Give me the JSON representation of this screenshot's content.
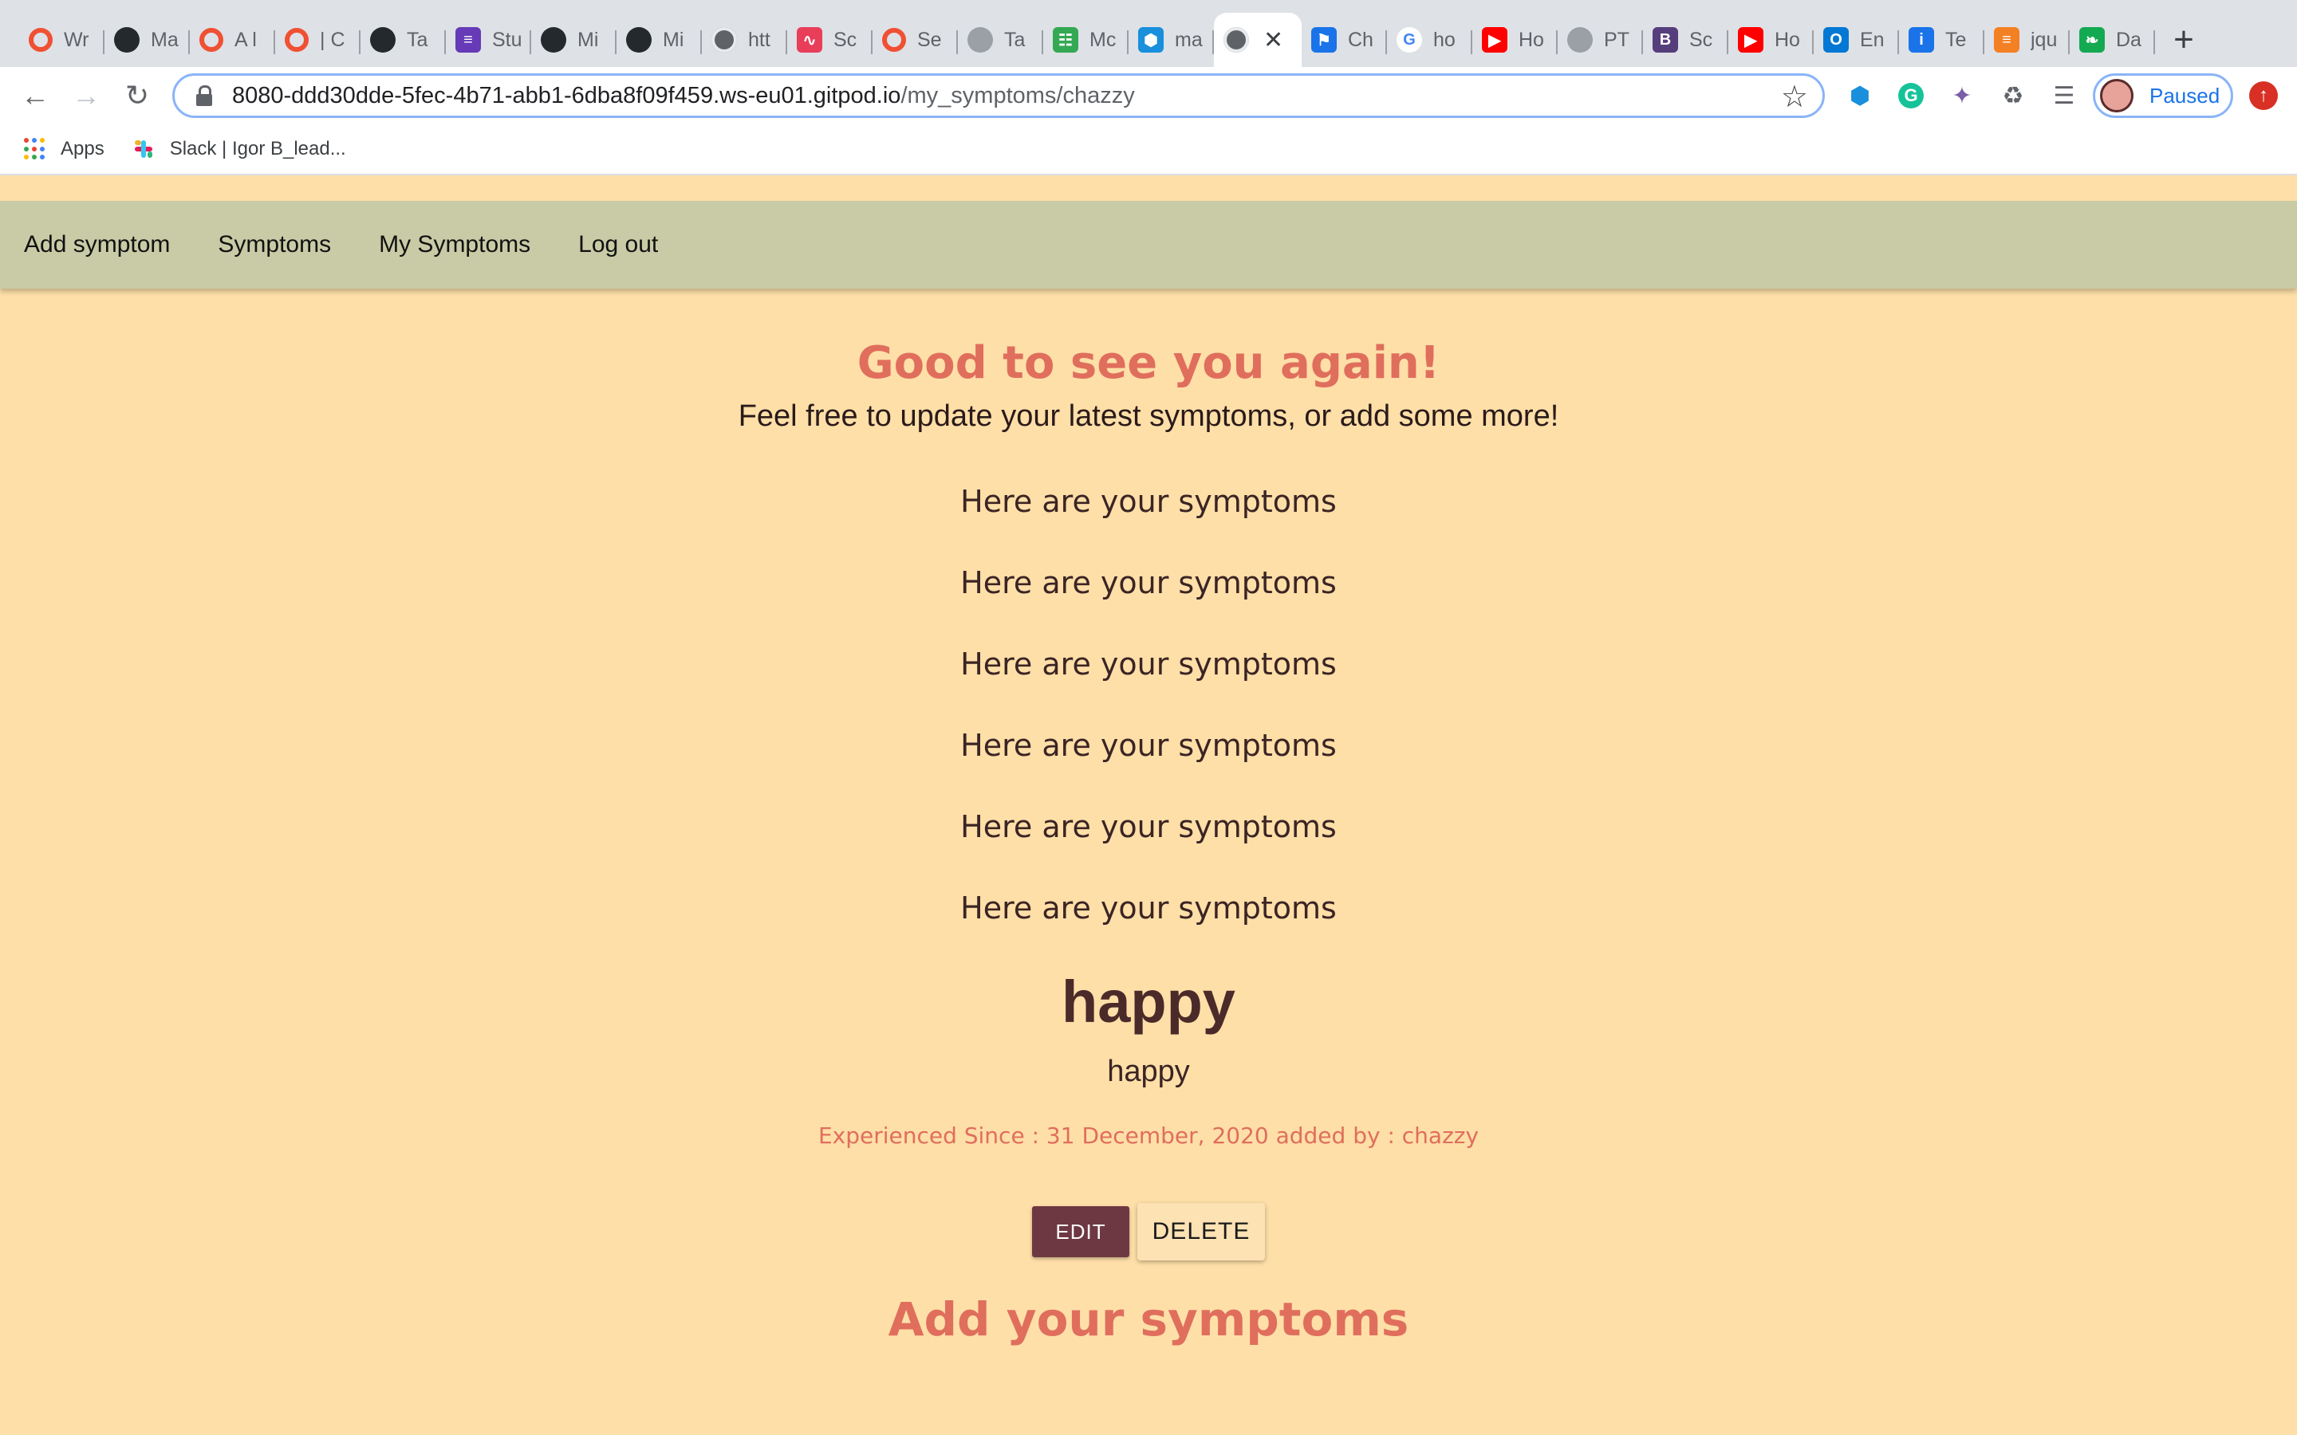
{
  "browser": {
    "tabs": [
      {
        "title": "Wr",
        "icon": "circle-orange-icon",
        "color": "#f05033"
      },
      {
        "title": "Ma",
        "icon": "github-icon",
        "color": "#24292e"
      },
      {
        "title": "A l",
        "icon": "circle-orange-icon",
        "color": "#f05033"
      },
      {
        "title": "| C",
        "icon": "circle-orange-icon",
        "color": "#f05033"
      },
      {
        "title": "Ta",
        "icon": "github-icon",
        "color": "#24292e"
      },
      {
        "title": "Stu",
        "icon": "list-purple-icon",
        "color": "#673ab7"
      },
      {
        "title": "Mi",
        "icon": "github-icon",
        "color": "#24292e"
      },
      {
        "title": "Mi",
        "icon": "github-icon",
        "color": "#24292e"
      },
      {
        "title": "htt",
        "icon": "globe-icon",
        "color": "#5f6368"
      },
      {
        "title": "Sc",
        "icon": "wave-red-icon",
        "color": "#e83e5a"
      },
      {
        "title": "Se",
        "icon": "circle-orange-icon",
        "color": "#f05033"
      },
      {
        "title": "Ta",
        "icon": "github-grey-icon",
        "color": "#9aa0a6"
      },
      {
        "title": "Mc",
        "icon": "sheet-green-icon",
        "color": "#34a853"
      },
      {
        "title": "ma",
        "icon": "hexagon-blue-icon",
        "color": "#1a8fdc"
      },
      {
        "title": "",
        "icon": "globe-icon",
        "color": "#5f6368",
        "active": true
      },
      {
        "title": "Ch",
        "icon": "flag-blue-icon",
        "color": "#1a73e8"
      },
      {
        "title": "ho",
        "icon": "google-icon",
        "color": "#4285f4"
      },
      {
        "title": "Ho",
        "icon": "youtube-icon",
        "color": "#ff0000"
      },
      {
        "title": "PT",
        "icon": "github-grey-icon",
        "color": "#9aa0a6"
      },
      {
        "title": "Sc",
        "icon": "bootstrap-icon",
        "color": "#563d7c"
      },
      {
        "title": "Ho",
        "icon": "youtube-icon",
        "color": "#ff0000"
      },
      {
        "title": "En",
        "icon": "outlook-icon",
        "color": "#0078d4"
      },
      {
        "title": "Te",
        "icon": "info-blue-icon",
        "color": "#1a73e8"
      },
      {
        "title": "jqu",
        "icon": "stackoverflow-icon",
        "color": "#f48024"
      },
      {
        "title": "Da",
        "icon": "leaf-green-icon",
        "color": "#13aa52"
      }
    ],
    "url_host": "8080-ddd30dde-5fec-4b71-abb1-6dba8f09f459.ws-eu01.gitpod.io",
    "url_path": "/my_symptoms/chazzy",
    "profile_label": "Paused",
    "bookmarks": [
      {
        "label": "Apps",
        "icon": "apps-grid-icon"
      },
      {
        "label": "Slack | Igor B_lead...",
        "icon": "slack-icon"
      }
    ]
  },
  "nav": {
    "add_symptom": "Add symptom",
    "symptoms": "Symptoms",
    "my_symptoms": "My Symptoms",
    "log_out": "Log out"
  },
  "main": {
    "welcome": "Good to see you again!",
    "subtitle": "Feel free to update your latest symptoms, or add some more!",
    "section_headings": [
      "Here are your symptoms",
      "Here are your symptoms",
      "Here are your symptoms",
      "Here are your symptoms",
      "Here are your symptoms",
      "Here are your symptoms"
    ],
    "symptom": {
      "name": "happy",
      "description": "happy",
      "meta": "Experienced Since : 31 December, 2020 added by : chazzy"
    },
    "edit_label": "EDIT",
    "delete_label": "DELETE",
    "add_title": "Add your symptoms"
  },
  "colors": {
    "page_bg": "#fedfa8",
    "nav_bg": "#c8cba5",
    "accent": "#e06e5d",
    "edit_bg": "#6e3842"
  }
}
